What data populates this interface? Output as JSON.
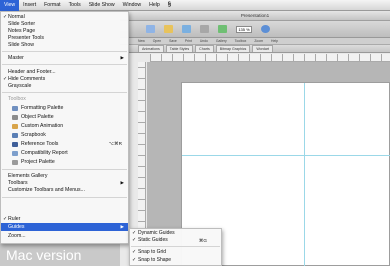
{
  "menubar": {
    "items": [
      "View",
      "Insert",
      "Format",
      "Tools",
      "Slide Show",
      "Window",
      "Help"
    ],
    "script_icon": "script-menu-icon"
  },
  "window": {
    "title": "Presentation1",
    "zoom": "135 %",
    "toolbar_labels": [
      "New",
      "Open",
      "Save",
      "Print",
      "Undo",
      "Gallery",
      "Toolbox",
      "Zoom",
      "Help"
    ],
    "ribbon_tabs": [
      "Animations",
      "Table Styles",
      "Charts",
      "Bitmap Graphics",
      "Wordart"
    ]
  },
  "view_menu": {
    "items": [
      {
        "label": "Normal",
        "checked": true
      },
      {
        "label": "Slide Sorter"
      },
      {
        "label": "Notes Page"
      },
      {
        "label": "Presenter Tools"
      },
      {
        "label": "Slide Show"
      },
      {
        "label": "Master",
        "submenu": true
      },
      {
        "label": "Header and Footer..."
      },
      {
        "label": "Hide Comments",
        "checked": true
      },
      {
        "label": "Grayscale"
      },
      {
        "label": "Toolbox",
        "disabled": true
      },
      {
        "label": "Formatting Palette",
        "icon": "formatting-palette-icon"
      },
      {
        "label": "Object Palette",
        "icon": "object-palette-icon"
      },
      {
        "label": "Custom Animation",
        "icon": "custom-animation-icon"
      },
      {
        "label": "Scrapbook",
        "icon": "scrapbook-icon"
      },
      {
        "label": "Reference Tools",
        "icon": "reference-tools-icon",
        "shortcut": "⌥⌘R"
      },
      {
        "label": "Compatibility Report",
        "icon": "compatibility-report-icon"
      },
      {
        "label": "Project Palette",
        "icon": "project-palette-icon"
      },
      {
        "label": "Elements Gallery"
      },
      {
        "label": "Toolbars",
        "submenu": true
      },
      {
        "label": "Customize Toolbars and Menus..."
      },
      {
        "label": "Ruler",
        "checked": true
      },
      {
        "label": "Guides",
        "submenu": true,
        "highlighted": true
      },
      {
        "label": "Zoom..."
      }
    ]
  },
  "guides_submenu": {
    "items": [
      {
        "label": "Dynamic Guides",
        "checked": true
      },
      {
        "label": "Static Guides",
        "checked": true,
        "shortcut": "⌘G"
      },
      {
        "label": "Snap to Grid",
        "checked": true
      },
      {
        "label": "Snap to Shape",
        "checked": true
      }
    ]
  },
  "caption": "Mac version",
  "colors": {
    "highlight": "#2d63d6",
    "guide": "#9bd8e8"
  }
}
